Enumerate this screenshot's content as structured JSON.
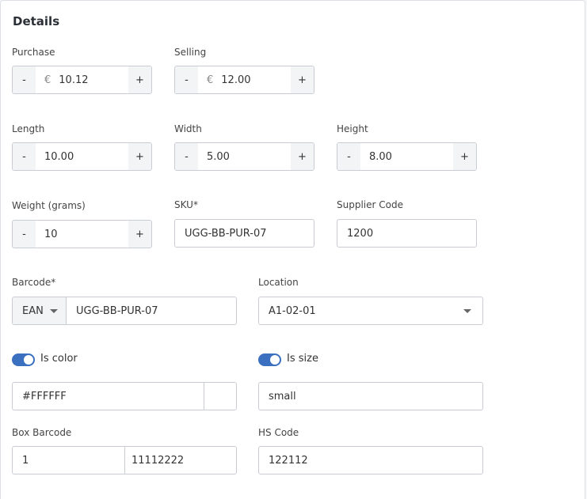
{
  "section_title": "Details",
  "purchase": {
    "label": "Purchase",
    "currency": "€",
    "value": "10.12",
    "minus": "-",
    "plus": "+"
  },
  "selling": {
    "label": "Selling",
    "currency": "€",
    "value": "12.00",
    "minus": "-",
    "plus": "+"
  },
  "length": {
    "label": "Length",
    "value": "10.00",
    "minus": "-",
    "plus": "+"
  },
  "width": {
    "label": "Width",
    "value": "5.00",
    "minus": "-",
    "plus": "+"
  },
  "height": {
    "label": "Height",
    "value": "8.00",
    "minus": "-",
    "plus": "+"
  },
  "weight": {
    "label": "Weight (grams)",
    "value": "10",
    "minus": "-",
    "plus": "+"
  },
  "sku": {
    "label": "SKU*",
    "value": "UGG-BB-PUR-07"
  },
  "supplier_code": {
    "label": "Supplier Code",
    "value": "1200"
  },
  "barcode": {
    "label": "Barcode*",
    "type": "EAN",
    "value": "UGG-BB-PUR-07"
  },
  "location": {
    "label": "Location",
    "value": "A1-02-01"
  },
  "is_color": {
    "label": "Is color",
    "on": true,
    "value": "#FFFFFF",
    "swatch": "#FFFFFF"
  },
  "is_size": {
    "label": "Is size",
    "on": true,
    "value": "small"
  },
  "box_barcode": {
    "label": "Box Barcode",
    "value1": "1",
    "value2": "11112222"
  },
  "hs_code": {
    "label": "HS Code",
    "value": "122112"
  },
  "colors": {
    "accent": "#3b6fbf",
    "border": "#c9cdd3",
    "button_bg": "#f3f4f6"
  }
}
